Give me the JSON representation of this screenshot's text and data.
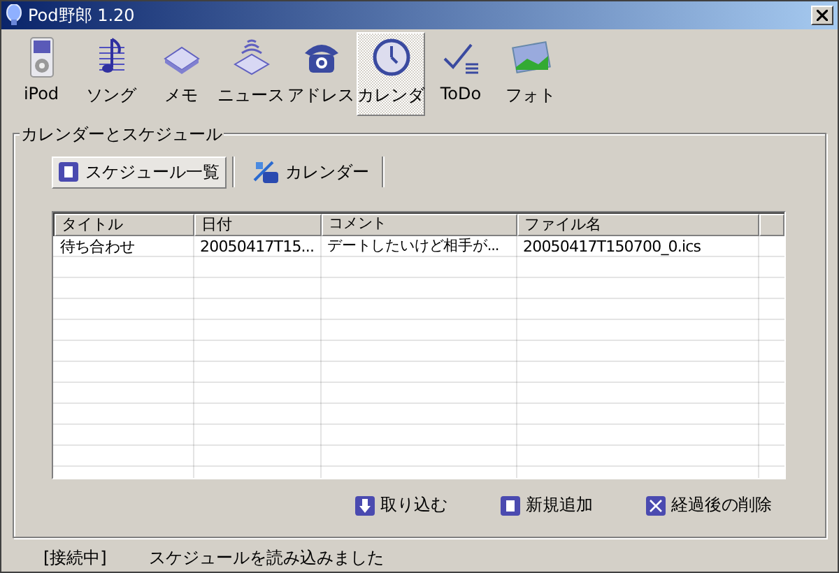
{
  "window": {
    "title": "Pod野郎 1.20"
  },
  "toolbar": [
    {
      "label": "iPod",
      "selected": false
    },
    {
      "label": "ソング",
      "selected": false
    },
    {
      "label": "メモ",
      "selected": false
    },
    {
      "label": "ニュース",
      "selected": false
    },
    {
      "label": "アドレス",
      "selected": false
    },
    {
      "label": "カレンダ",
      "selected": true
    },
    {
      "label": "ToDo",
      "selected": false
    },
    {
      "label": "フォト",
      "selected": false
    }
  ],
  "group": {
    "title": "カレンダーとスケジュール"
  },
  "subtabs": [
    {
      "label": "スケジュール一覧",
      "selected": true
    },
    {
      "label": "カレンダー",
      "selected": false
    }
  ],
  "table": {
    "columns": [
      "タイトル",
      "日付",
      "コメント",
      "ファイル名"
    ],
    "rows": [
      [
        "待ち合わせ",
        "20050417T15...",
        "デートしたいけど相手が...",
        "20050417T150700_0.ics"
      ]
    ]
  },
  "actions": [
    "取り込む",
    "新規追加",
    "経過後の削除"
  ],
  "status_bar": {
    "connection": "[接続中]",
    "message": "スケジュールを読み込みました"
  }
}
